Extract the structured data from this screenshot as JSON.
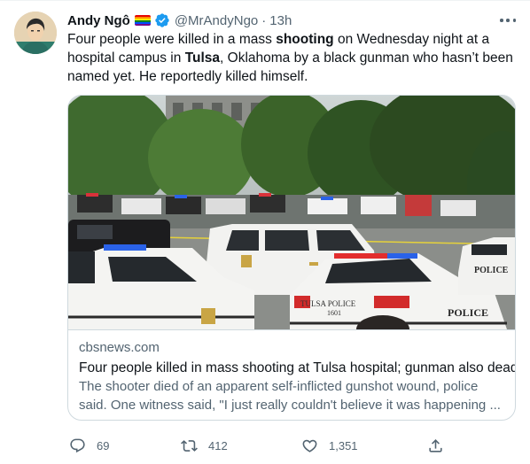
{
  "author": {
    "name": "Andy Ngô",
    "handle": "@MrAndyNgo",
    "separator": "·",
    "time": "13h"
  },
  "tweet": {
    "parts": [
      {
        "t": "Four people were killed in a mass ",
        "b": false
      },
      {
        "t": "shooting",
        "b": true
      },
      {
        "t": " on Wednesday night at a hospital campus in ",
        "b": false
      },
      {
        "t": "Tulsa",
        "b": true
      },
      {
        "t": ", Oklahoma by a black gunman who hasn’t been named yet. He reportedly killed himself.",
        "b": false
      }
    ]
  },
  "card": {
    "domain": "cbsnews.com",
    "title": "Four people killed in mass shooting at Tulsa hospital; gunman also dead",
    "description": "The shooter died of an apparent self-inflicted gunshot wound, police said. One witness said, \"I just really couldn't believe it was happening ...",
    "photo_labels": {
      "car1": "TULSA POLICE",
      "car1_number": "1601",
      "car2": "POLICE",
      "car3": "POLICE"
    }
  },
  "actions": {
    "reply_count": "69",
    "retweet_count": "412",
    "like_count": "1,351"
  },
  "colors": {
    "text": "#0f1419",
    "secondary": "#536471",
    "verified": "#1d9bf0",
    "border": "#cfd9de"
  },
  "icons": [
    "more-icon",
    "verified-badge-icon",
    "pride-flag-icon",
    "reply-icon",
    "retweet-icon",
    "like-icon",
    "share-icon"
  ]
}
